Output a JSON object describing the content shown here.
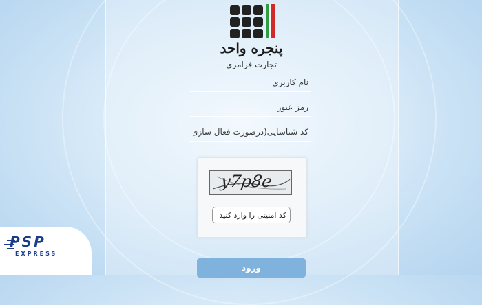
{
  "brand": {
    "title": "پنجره واحد",
    "subtitle": "تجارت فرامزی"
  },
  "form": {
    "username_placeholder": "نام کاربري",
    "password_placeholder": "رمز عبور",
    "id_code_placeholder": "کد شناسایی(درصورت فعال سازی)",
    "captcha_text": "y7p8e",
    "captcha_placeholder": "کد امنیتی را وارد کنید",
    "submit_label": "ورود"
  },
  "watermark": {
    "text": "PSP",
    "sub": "EXPRESS"
  },
  "colors": {
    "accent": "#7fb2dc",
    "logo_green": "#2e9e3f",
    "logo_red": "#d12a2a"
  }
}
